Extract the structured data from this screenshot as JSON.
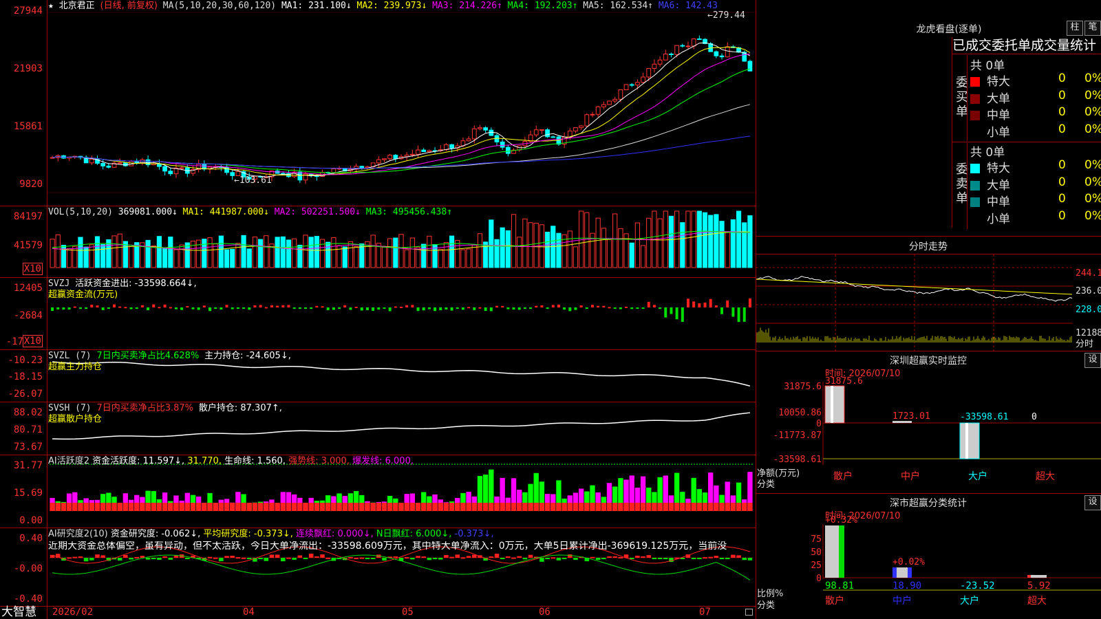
{
  "stock": {
    "name": "北京君正",
    "mode": "(日线, 前复权)",
    "ma_label": "MA(5,10,20,30,60,120)",
    "ma1": "MA1: 231.100↓",
    "ma2": "MA2: 239.973↓",
    "ma3": "MA3: 214.226↑",
    "ma4": "MA4: 192.203↑",
    "ma5": "MA5: 162.534↑",
    "ma6": "MA6: 142.43",
    "high_mark": "279.44",
    "low_mark": "103.61",
    "y_ticks": [
      "27944",
      "21903",
      "15861",
      "9820"
    ]
  },
  "vol": {
    "label": "VOL(5,10,20)",
    "value": "369081.000↓",
    "ma1": "MA1: 441987.000↓",
    "ma2": "MA2: 502251.500↓",
    "ma3": "MA3: 495456.438↑",
    "y_ticks": [
      "84197",
      "41579"
    ],
    "unit": "X10"
  },
  "svzj": {
    "label": "SVZJ",
    "value": "活跃资金进出: -33598.664↓,",
    "subtitle": "超赢资金流(万元)",
    "y_ticks": [
      "12405",
      "-2684",
      "-17"
    ],
    "unit": "X10"
  },
  "svzl": {
    "label": "SVZL (7)",
    "ratio": "7日内买卖净占比4.628%",
    "value": "主力持仓: -24.605↓,",
    "subtitle": "超赢主力持仓",
    "y_ticks": [
      "-10.23",
      "-18.15",
      "-26.07"
    ]
  },
  "svsh": {
    "label": "SVSH (7)",
    "ratio": "7日内买卖净占比3.87%",
    "value": "散户持仓: 87.307↑,",
    "subtitle": "超赢散户持仓",
    "y_ticks": [
      "88.02",
      "80.71",
      "73.67"
    ]
  },
  "ai1": {
    "label": "AI活跃度2",
    "v1": "资金活跃度: 11.597↓,",
    "v2": "31.770,",
    "v3": "生命线: 1.560,",
    "v4": "强势线: 3.000,",
    "v5": "爆发线: 6.000,",
    "y_ticks": [
      "31.77",
      "15.69",
      "0.00"
    ]
  },
  "ai2": {
    "label": "AI研究度2(10)",
    "v1": "资金研究度: -0.062↓,",
    "v2": "平均研究度: -0.373↓,",
    "v3": "连续飘红: 0.000↓,",
    "v4": "N日飘红: 6.000↓,",
    "v5": "-0.373↓,",
    "text": "近期大资金总体偏空，虽有异动，但不太活跃，今日大单净流出：-33598.609万元，其中特大单净流入：0万元，大单5日累计净出-369619.125万元，当前没",
    "y_ticks": [
      "0.40",
      "-0.00",
      "-0.40"
    ]
  },
  "xaxis": {
    "brand": "大智慧",
    "labels": [
      "2026/02",
      "04",
      "05",
      "06",
      "07"
    ]
  },
  "dragon": {
    "title": "龙虎看盘(逐单)",
    "btn1": "柱",
    "btn2": "笔",
    "tabs": "已成交委托单成交量统计",
    "buy_side": "委买单",
    "sell_side": "委卖单",
    "buy_total": "共 0单",
    "sell_total": "共 0单",
    "buy_rows": [
      {
        "name": "特大",
        "val": "0",
        "pct": "0%"
      },
      {
        "name": "大单",
        "val": "0",
        "pct": "0%"
      },
      {
        "name": "中单",
        "val": "0",
        "pct": "0%"
      },
      {
        "name": "小单",
        "val": "0",
        "pct": "0%"
      }
    ],
    "sell_rows": [
      {
        "name": "特大",
        "val": "0",
        "pct": "0%"
      },
      {
        "name": "大单",
        "val": "0",
        "pct": "0%"
      },
      {
        "name": "中单",
        "val": "0",
        "pct": "0%"
      },
      {
        "name": "小单",
        "val": "0",
        "pct": "0%"
      }
    ],
    "buy_colors": [
      "#ff0000",
      "#8b0000",
      "#7a0000",
      "#000000"
    ],
    "sell_colors": [
      "#00ffff",
      "#008b8b",
      "#008080",
      "#000000"
    ]
  },
  "intraday": {
    "title": "分时走势",
    "y_ticks": [
      "244.1",
      "236.0",
      "228.0",
      "12188"
    ],
    "unit": "分时"
  },
  "monitor": {
    "title": "深圳超赢实时监控",
    "btn": "设",
    "time": "时间: 2026/07/10",
    "y_ticks": [
      "31875.6",
      "10050.86",
      "0",
      "-11773.87",
      "-33598.61"
    ],
    "bar_labels": [
      "31875.6",
      "1723.01",
      "-33598.61",
      "0"
    ],
    "unit": "净额(万元)",
    "unit2": "分类",
    "categories": [
      "散户",
      "中户",
      "大户",
      "超大"
    ]
  },
  "classify": {
    "title": "深市超赢分类统计",
    "btn": "设",
    "time": "时间: 2026/07/10",
    "y_ticks": [
      "75",
      "50",
      "25",
      "0"
    ],
    "top_labels": [
      "+0.32%",
      "+0.02%"
    ],
    "bottom_values": [
      "98.81",
      "18.90",
      "-23.52",
      "5.92"
    ],
    "unit": "比例%",
    "unit2": "分类",
    "categories": [
      "散户",
      "中户",
      "大户",
      "超大"
    ]
  }
}
